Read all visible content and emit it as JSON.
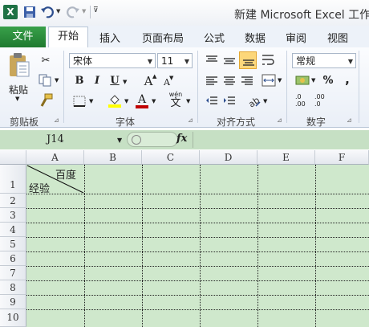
{
  "window": {
    "title": "新建 Microsoft Excel 工作表"
  },
  "ribbon_tabs": [
    "文件",
    "开始",
    "插入",
    "页面布局",
    "公式",
    "数据",
    "审阅",
    "视图"
  ],
  "ribbon": {
    "clipboard": {
      "paste_label": "粘贴",
      "group_label": "剪贴板"
    },
    "font": {
      "name": "宋体",
      "size": "11",
      "group_label": "字体",
      "bold": "B",
      "italic": "I",
      "underline": "U",
      "grow": "A",
      "shrink": "A",
      "strike_a": "A",
      "wen": "wén",
      "wen_char": "文"
    },
    "alignment": {
      "group_label": "对齐方式"
    },
    "number": {
      "format": "常规",
      "group_label": "数字",
      "percent": "%",
      "comma": ",",
      "dec_inc": ".0",
      "dec_inc2": ".00",
      "dec_dec": ".00",
      "dec_dec2": ".0"
    }
  },
  "formula_bar": {
    "name_box": "J14",
    "fx": "fx",
    "formula": ""
  },
  "sheet": {
    "columns": [
      "A",
      "B",
      "C",
      "D",
      "E",
      "F"
    ],
    "rows": [
      "1",
      "2",
      "3",
      "4",
      "5",
      "6",
      "7",
      "8",
      "9",
      "10"
    ],
    "cell_a1_top": "百度",
    "cell_a1_bottom": "经验"
  },
  "colors": {
    "file_tab": "#2a8c3c",
    "sheet_fill": "#cfe8cc",
    "formula_bar": "#c6e0c4",
    "font_color": "#c00000",
    "highlight": "#ffff00"
  }
}
